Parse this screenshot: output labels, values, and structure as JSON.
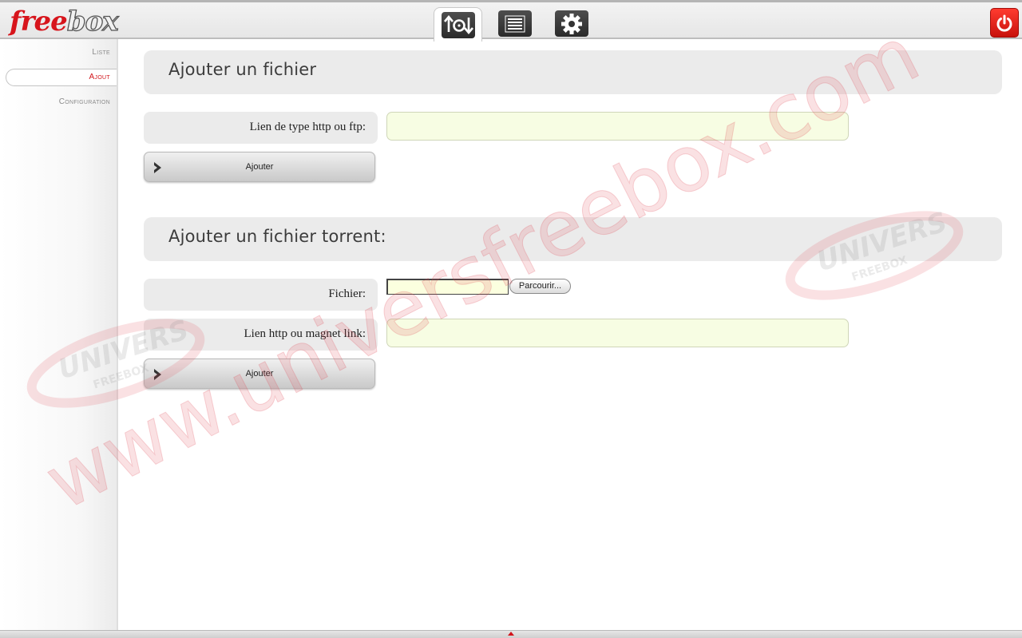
{
  "header": {
    "logo_part1": "free",
    "logo_part2": "box",
    "tabs": [
      {
        "icon": "upload-download-icon",
        "active": true
      },
      {
        "icon": "list-icon",
        "active": false
      },
      {
        "icon": "gear-icon",
        "active": false
      }
    ],
    "power_icon": "power-icon"
  },
  "sidebar": {
    "items": [
      {
        "label": "Liste",
        "active": false
      },
      {
        "label": "Ajout",
        "active": true
      },
      {
        "label": "Configuration",
        "active": false
      }
    ]
  },
  "section1": {
    "title": "Ajouter un fichier",
    "url_label": "Lien de type http ou ftp:",
    "url_value": "",
    "submit_label": "Ajouter"
  },
  "section2": {
    "title": "Ajouter un fichier torrent:",
    "file_label": "Fichier:",
    "file_value": "",
    "browse_label": "Parcourir...",
    "magnet_label": "Lien http ou magnet link:",
    "magnet_value": "",
    "submit_label": "Ajouter"
  },
  "watermark": {
    "url": "www.universfreebox.com",
    "badge_line1": "UNIVERS",
    "badge_line2": "FREEBOX"
  },
  "colors": {
    "brand_red": "#d7151c",
    "input_bg": "#f7fde3",
    "panel_grey": "#ebebeb"
  }
}
